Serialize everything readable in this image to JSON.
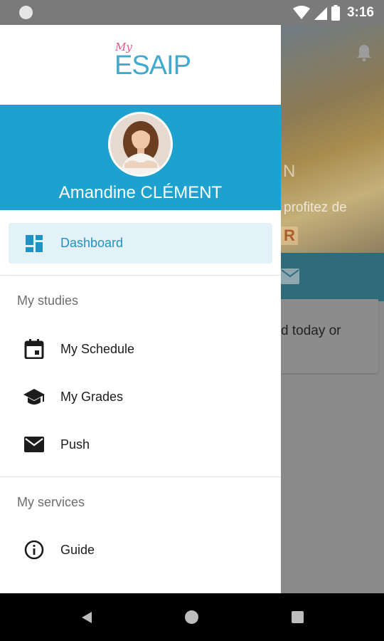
{
  "status_bar": {
    "time": "3:16"
  },
  "background_app": {
    "banner_letter": "N",
    "banner_text": "profitez de",
    "banner_badge": "R",
    "card_text": "d today or"
  },
  "drawer": {
    "logo": {
      "my": "My",
      "name": "ESAIP"
    },
    "user_name": "Amandine CLÉMENT",
    "active_item": {
      "label": "Dashboard",
      "icon": "dashboard-icon"
    },
    "sections": [
      {
        "title": "My studies",
        "items": [
          {
            "label": "My Schedule",
            "icon": "calendar-icon"
          },
          {
            "label": "My Grades",
            "icon": "graduation-cap-icon"
          },
          {
            "label": "Push",
            "icon": "mail-icon"
          }
        ]
      },
      {
        "title": "My services",
        "items": [
          {
            "label": "Guide",
            "icon": "info-icon"
          }
        ]
      }
    ]
  },
  "colors": {
    "accent": "#1da2cf",
    "active_bg": "#e3f1f8",
    "active_text": "#1f93c3",
    "logo_pink": "#e0568b",
    "logo_blue": "#41aad0"
  }
}
